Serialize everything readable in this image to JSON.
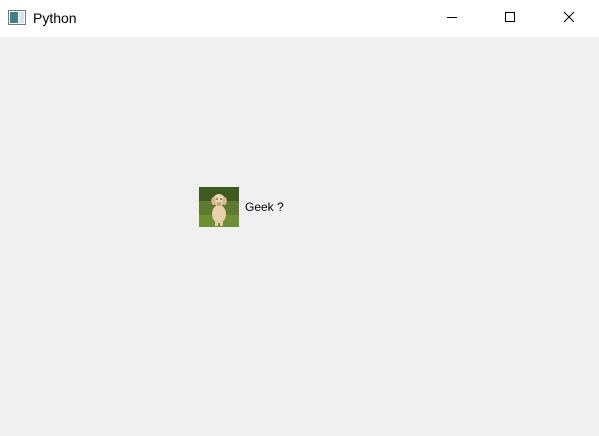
{
  "window": {
    "title": "Python",
    "icon": "python-app-icon",
    "controls": {
      "minimize_icon": "minimize-icon",
      "maximize_icon": "maximize-icon",
      "close_icon": "close-icon"
    }
  },
  "content": {
    "image": "puppy-photo",
    "label": "Geek ?"
  },
  "colors": {
    "background": "#f0f0f0",
    "titlebar": "#ffffff"
  }
}
